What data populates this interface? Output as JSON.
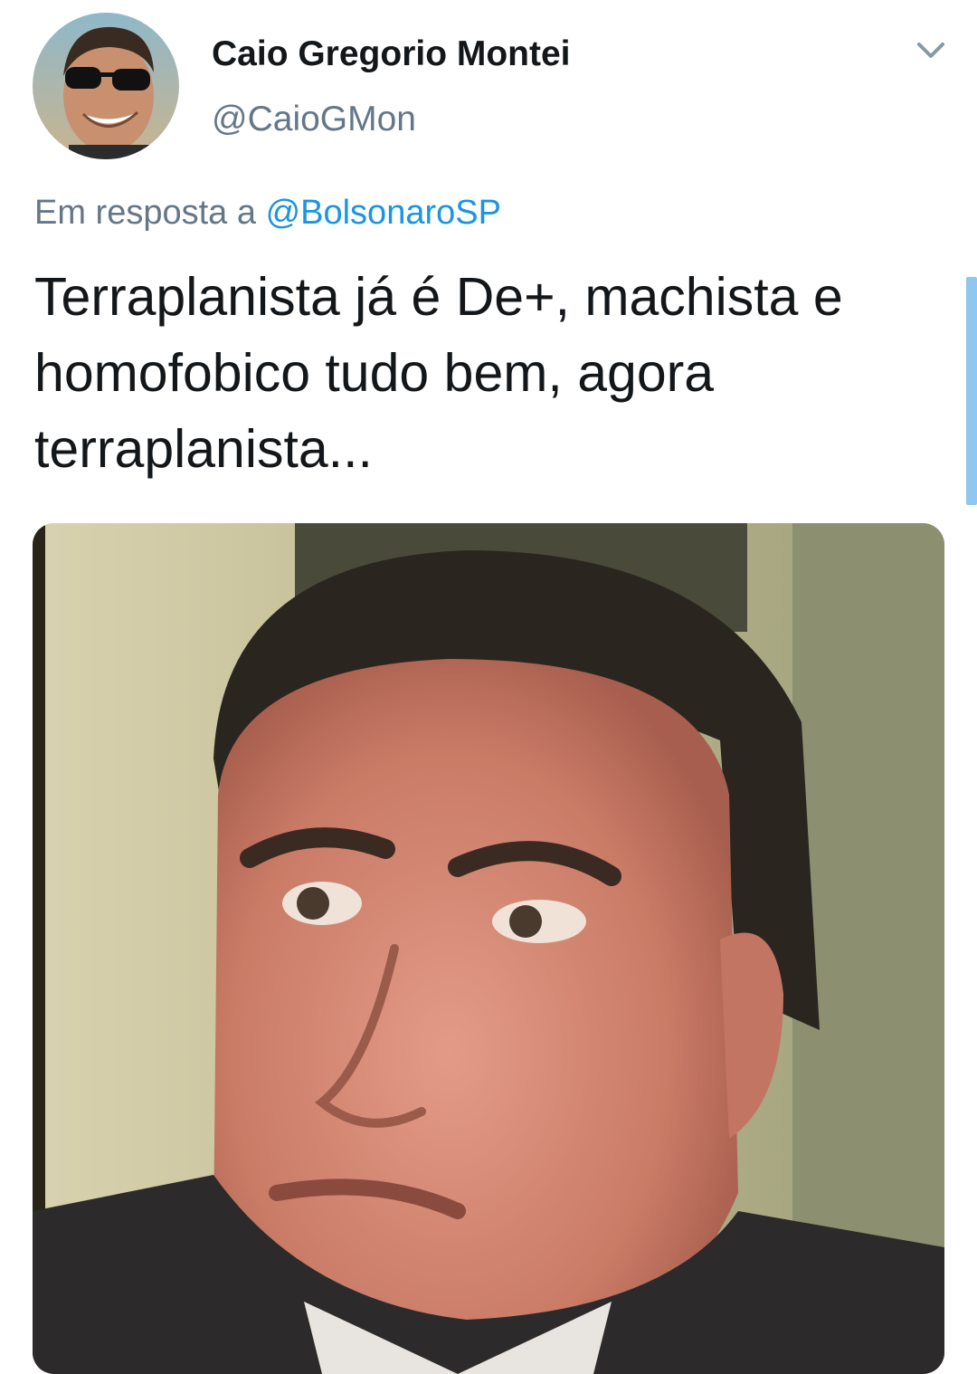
{
  "tweet": {
    "author": {
      "display_name": "Caio Gregorio Montei",
      "handle": "@CaioGMon",
      "avatar_icon": "profile-photo"
    },
    "menu_icon": "chevron-down-icon",
    "reply_to": {
      "prefix": "Em resposta a",
      "handle": "@BolsonaroSP"
    },
    "text": "Terraplanista já é De+, machista e homofobico tudo bem, agora terraplanista...",
    "media": {
      "type": "photo"
    }
  },
  "colors": {
    "text_primary": "#14171a",
    "text_secondary": "#657786",
    "link": "#1b95e0",
    "scroll_indicator": "#8fc7f0"
  }
}
